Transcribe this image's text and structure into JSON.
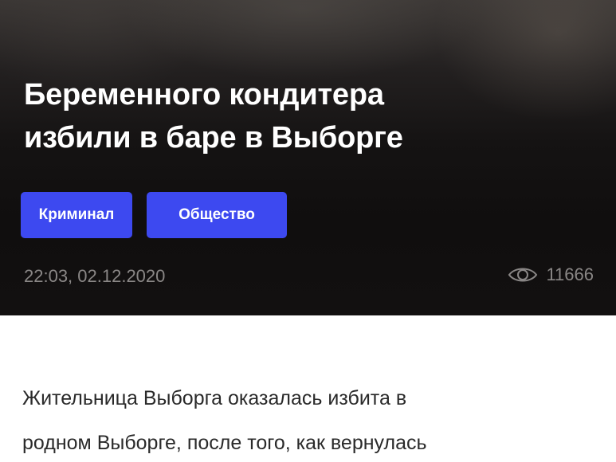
{
  "article": {
    "title_line1": "Беременного кондитера",
    "title_line2": "избили в баре в Выборге",
    "tags": [
      "Криминал",
      "Общество"
    ],
    "date": "22:03, 02.12.2020",
    "views": "11666",
    "body_line1": "Жительница Выборга оказалась избита в",
    "body_line2": "родном Выборге, после того, как вернулась"
  },
  "icons": {
    "views": "eye-icon"
  },
  "colors": {
    "tag_background": "#3d49f0",
    "hero_background": "#121010",
    "meta_text": "#8a8786"
  }
}
